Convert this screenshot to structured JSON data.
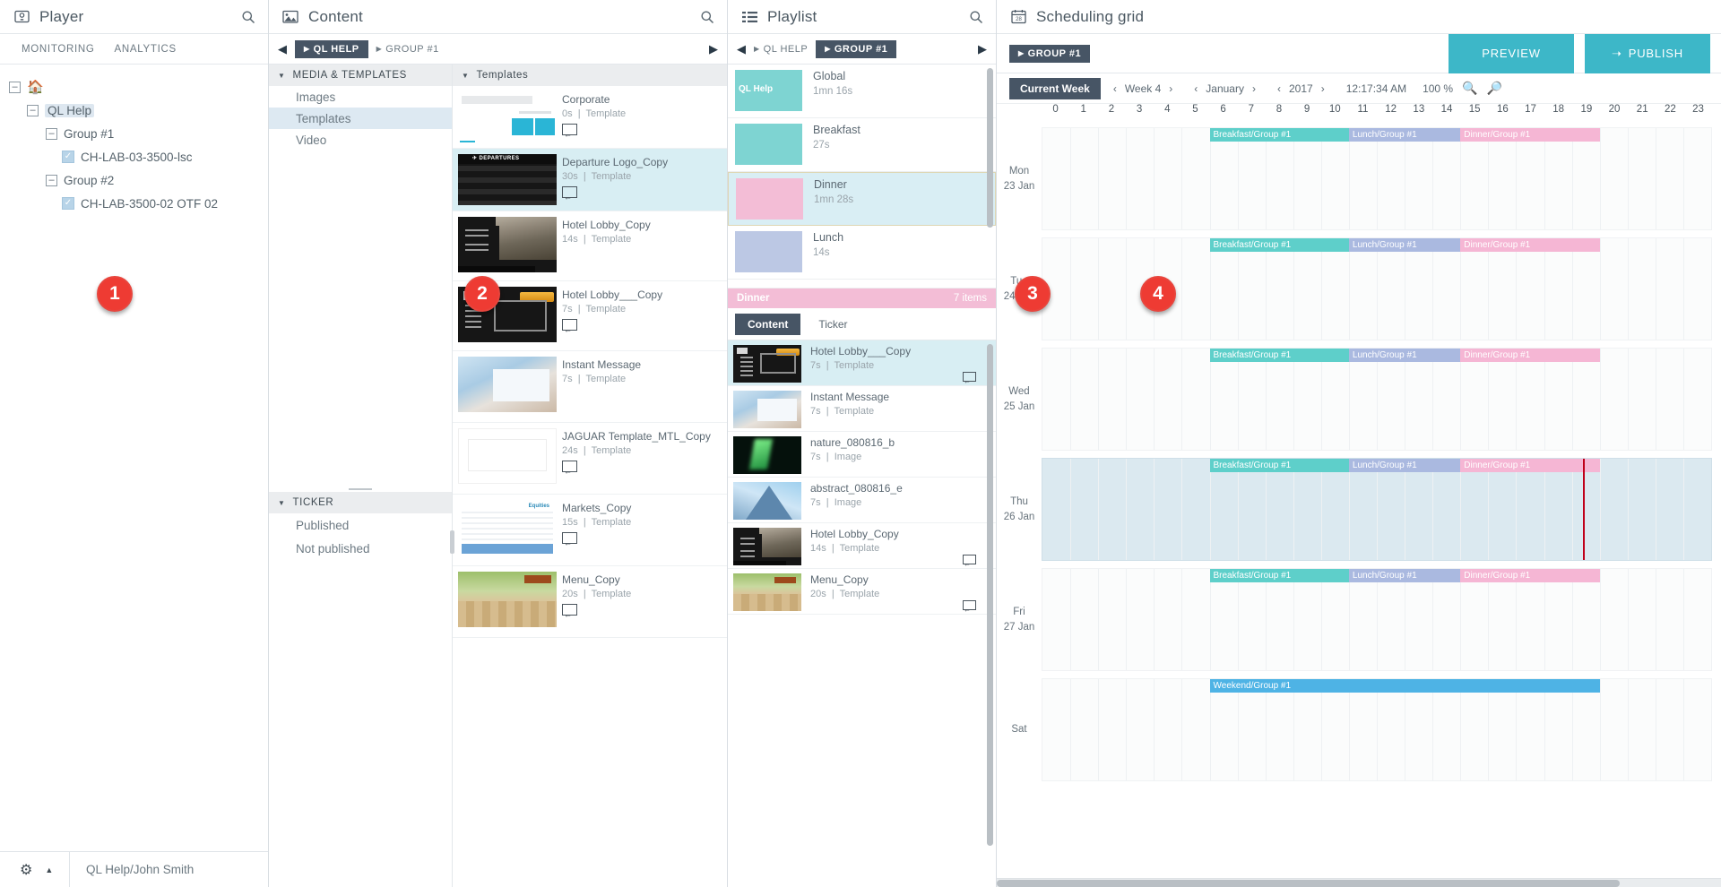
{
  "player": {
    "title": "Player",
    "icon": "player-icon",
    "search_icon": "search-icon",
    "tabs": [
      {
        "label": "MONITORING"
      },
      {
        "label": "ANALYTICS"
      }
    ],
    "tree": [
      {
        "label": "",
        "icon": "home-icon",
        "level": 0,
        "type": "root"
      },
      {
        "label": "QL Help",
        "level": 1,
        "type": "folder",
        "selected": true
      },
      {
        "label": "Group #1",
        "level": 2,
        "type": "folder"
      },
      {
        "label": "CH-LAB-03-3500-lsc",
        "level": 3,
        "type": "player",
        "checked": true
      },
      {
        "label": "Group #2",
        "level": 2,
        "type": "folder"
      },
      {
        "label": "CH-LAB-3500-02 OTF 02",
        "level": 3,
        "type": "player",
        "checked": true
      }
    ],
    "footer": {
      "gear_icon": "gear-icon",
      "caret_icon": "caret-up-icon",
      "user": "QL Help/John Smith"
    }
  },
  "content": {
    "title": "Content",
    "icon": "image-icon",
    "search_icon": "search-icon",
    "breadcrumb": {
      "prev_icon": "prev-arrow-icon",
      "next_icon": "next-arrow-icon",
      "items": [
        {
          "label": "QL HELP",
          "active": true
        },
        {
          "label": "GROUP #1",
          "active": false
        }
      ]
    },
    "sections": [
      {
        "label": "MEDIA & TEMPLATES",
        "items": [
          {
            "label": "Images",
            "active": false
          },
          {
            "label": "Templates",
            "active": true
          },
          {
            "label": "Video",
            "active": false
          }
        ]
      },
      {
        "label": "TICKER",
        "items": [
          {
            "label": "Published",
            "active": false
          },
          {
            "label": "Not published",
            "active": false
          }
        ]
      }
    ],
    "list_header": "Templates",
    "templates": [
      {
        "name": "Corporate",
        "duration": "0s",
        "kind": "Template",
        "art": "corp",
        "badge": true,
        "selected": false
      },
      {
        "name": "Departure Logo_Copy",
        "duration": "30s",
        "kind": "Template",
        "art": "departures",
        "badge": true,
        "selected": true
      },
      {
        "name": "Hotel Lobby_Copy",
        "duration": "14s",
        "kind": "Template",
        "art": "lobby",
        "badge": false,
        "selected": false
      },
      {
        "name": "Hotel Lobby___Copy",
        "duration": "7s",
        "kind": "Template",
        "art": "hotel",
        "badge": true,
        "selected": false
      },
      {
        "name": "Instant Message",
        "duration": "7s",
        "kind": "Template",
        "art": "instant",
        "badge": false,
        "selected": false
      },
      {
        "name": "JAGUAR Template_MTL_Copy",
        "duration": "24s",
        "kind": "Template",
        "art": "jaguar",
        "badge": true,
        "selected": false
      },
      {
        "name": "Markets_Copy",
        "duration": "15s",
        "kind": "Template",
        "art": "markets",
        "badge": true,
        "selected": false
      },
      {
        "name": "Menu_Copy",
        "duration": "20s",
        "kind": "Template",
        "art": "menu",
        "badge": true,
        "selected": false
      }
    ]
  },
  "playlist": {
    "title": "Playlist",
    "icon": "list-icon",
    "search_icon": "search-icon",
    "breadcrumb": {
      "prev_icon": "prev-arrow-icon",
      "next_icon": "next-arrow-icon",
      "items": [
        {
          "label": "QL HELP",
          "active": false
        },
        {
          "label": "GROUP #1",
          "active": true
        }
      ]
    },
    "playlists": [
      {
        "name": "Global",
        "duration": "1mn 16s",
        "swatch": "#7ed4d2",
        "overlay": "QL Help",
        "selected": false
      },
      {
        "name": "Breakfast",
        "duration": "27s",
        "swatch": "#7ed4d2",
        "overlay": "",
        "selected": false
      },
      {
        "name": "Dinner",
        "duration": "1mn 28s",
        "swatch": "#f3bdd6",
        "overlay": "",
        "selected": true
      },
      {
        "name": "Lunch",
        "duration": "14s",
        "swatch": "#bcc8e4",
        "overlay": "",
        "selected": false
      }
    ],
    "detail_header": {
      "name": "Dinner",
      "count": "7 items",
      "color": "#f3bdd6"
    },
    "tabs": [
      {
        "label": "Content",
        "active": true
      },
      {
        "label": "Ticker",
        "active": false
      }
    ],
    "items": [
      {
        "name": "Hotel Lobby___Copy",
        "duration": "7s",
        "kind": "Template",
        "art": "hotel",
        "badge": true,
        "selected": true
      },
      {
        "name": "Instant Message",
        "duration": "7s",
        "kind": "Template",
        "art": "instant",
        "badge": false,
        "selected": false
      },
      {
        "name": "nature_080816_b",
        "duration": "7s",
        "kind": "Image",
        "art": "nature",
        "badge": false,
        "selected": false
      },
      {
        "name": "abstract_080816_e",
        "duration": "7s",
        "kind": "Image",
        "art": "abstract",
        "badge": false,
        "selected": false
      },
      {
        "name": "Hotel Lobby_Copy",
        "duration": "14s",
        "kind": "Template",
        "art": "lobby",
        "badge": true,
        "selected": false
      },
      {
        "name": "Menu_Copy",
        "duration": "20s",
        "kind": "Template",
        "art": "menu",
        "badge": true,
        "selected": false
      }
    ]
  },
  "scheduling": {
    "title": "Scheduling grid",
    "icon": "calendar-icon",
    "breadcrumb": {
      "items": [
        {
          "label": "GROUP #1",
          "active": true
        }
      ]
    },
    "preview_label": "PREVIEW",
    "publish_label": "PUBLISH",
    "publish_icon": "arrow-right-icon",
    "toolbar": {
      "current_week_label": "Current Week",
      "week": "Week 4",
      "month": "January",
      "year": "2017",
      "time": "12:17:34 AM",
      "zoom": "100 %",
      "zoom_in_icon": "zoom-in-icon",
      "zoom_out_icon": "zoom-out-icon",
      "prev_icon": "chevron-left-icon",
      "next_icon": "chevron-right-icon"
    },
    "hours": [
      "0",
      "1",
      "2",
      "3",
      "4",
      "5",
      "6",
      "7",
      "8",
      "9",
      "10",
      "11",
      "12",
      "13",
      "14",
      "15",
      "16",
      "17",
      "18",
      "19",
      "20",
      "21",
      "22",
      "23"
    ],
    "now_hour": 19.4,
    "event_colors": {
      "breakfast": "#5ecfca",
      "lunch": "#aab9e0",
      "dinner": "#f5b6d4",
      "weekend": "#4eb3e5"
    },
    "days": [
      {
        "dow": "Mon",
        "date": "23 Jan",
        "today": false,
        "events": [
          {
            "label": "Breakfast/Group #1",
            "start": 6,
            "end": 11,
            "color": "#5ecfca"
          },
          {
            "label": "Lunch/Group #1",
            "start": 11,
            "end": 15,
            "color": "#aab9e0"
          },
          {
            "label": "Dinner/Group #1",
            "start": 15,
            "end": 20,
            "color": "#f5b6d4"
          }
        ]
      },
      {
        "dow": "Tue",
        "date": "24 Jan",
        "today": false,
        "events": [
          {
            "label": "Breakfast/Group #1",
            "start": 6,
            "end": 11,
            "color": "#5ecfca"
          },
          {
            "label": "Lunch/Group #1",
            "start": 11,
            "end": 15,
            "color": "#aab9e0"
          },
          {
            "label": "Dinner/Group #1",
            "start": 15,
            "end": 20,
            "color": "#f5b6d4"
          }
        ]
      },
      {
        "dow": "Wed",
        "date": "25 Jan",
        "today": false,
        "events": [
          {
            "label": "Breakfast/Group #1",
            "start": 6,
            "end": 11,
            "color": "#5ecfca"
          },
          {
            "label": "Lunch/Group #1",
            "start": 11,
            "end": 15,
            "color": "#aab9e0"
          },
          {
            "label": "Dinner/Group #1",
            "start": 15,
            "end": 20,
            "color": "#f5b6d4"
          }
        ]
      },
      {
        "dow": "Thu",
        "date": "26 Jan",
        "today": true,
        "events": [
          {
            "label": "Breakfast/Group #1",
            "start": 6,
            "end": 11,
            "color": "#5ecfca"
          },
          {
            "label": "Lunch/Group #1",
            "start": 11,
            "end": 15,
            "color": "#aab9e0"
          },
          {
            "label": "Dinner/Group #1",
            "start": 15,
            "end": 20,
            "color": "#f5b6d4"
          }
        ]
      },
      {
        "dow": "Fri",
        "date": "27 Jan",
        "today": false,
        "events": [
          {
            "label": "Breakfast/Group #1",
            "start": 6,
            "end": 11,
            "color": "#5ecfca"
          },
          {
            "label": "Lunch/Group #1",
            "start": 11,
            "end": 15,
            "color": "#aab9e0"
          },
          {
            "label": "Dinner/Group #1",
            "start": 15,
            "end": 20,
            "color": "#f5b6d4"
          }
        ]
      },
      {
        "dow": "Sat",
        "date": "",
        "today": false,
        "events": [
          {
            "label": "Weekend/Group #1",
            "start": 6,
            "end": 20,
            "color": "#4eb3e5"
          }
        ]
      }
    ]
  },
  "callouts": [
    {
      "number": "1",
      "panel": "player"
    },
    {
      "number": "2",
      "panel": "content"
    },
    {
      "number": "3",
      "panel": "playlist"
    },
    {
      "number": "4",
      "panel": "scheduling"
    }
  ]
}
